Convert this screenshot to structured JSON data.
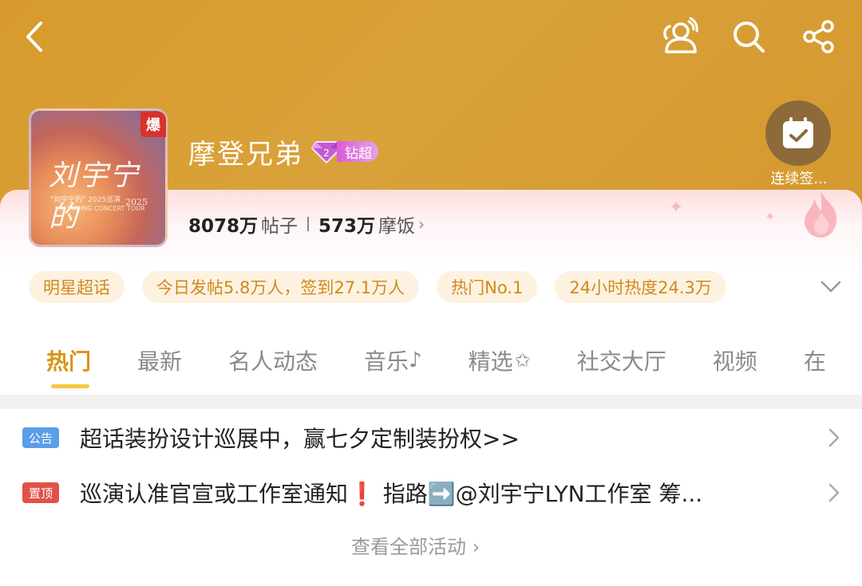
{
  "header": {
    "title": "摩登兄弟",
    "rank_label": "钻超",
    "hot_badge": "爆",
    "checkin_label": "连续签...",
    "avatar": {
      "title": "刘宇宁的",
      "subtitle": "\"刘宇宁的\" 2025巡演",
      "subtitle2": "LIU YUNING CONCERT TOUR",
      "year": "2025"
    }
  },
  "stats": {
    "posts_value": "8078万",
    "posts_label": "帖子",
    "fans_value": "573万",
    "fans_label": "摩饭"
  },
  "tags": [
    "明星超话",
    "今日发帖5.8万人，签到27.1万人",
    "热门No.1",
    "24小时热度24.3万"
  ],
  "tabs": [
    "热门",
    "最新",
    "名人动态",
    "音乐",
    "精选",
    "社交大厅",
    "视频",
    "在"
  ],
  "notices": [
    {
      "badge": "公告",
      "text": "超话装扮设计巡展中，赢七夕定制装扮权>>",
      "color": "#5b9ee8"
    },
    {
      "badge": "置顶",
      "text": "巡演认准官宣或工作室通知❗ 指路➡️@刘宇宁LYN工作室  筹...",
      "color": "#e05248"
    }
  ],
  "view_all": "查看全部活动 ›",
  "colors": {
    "header_bg": "#d89a2c",
    "accent": "#d99412",
    "tag_bg": "#fdf2e0",
    "tag_text": "#d08a1e"
  }
}
